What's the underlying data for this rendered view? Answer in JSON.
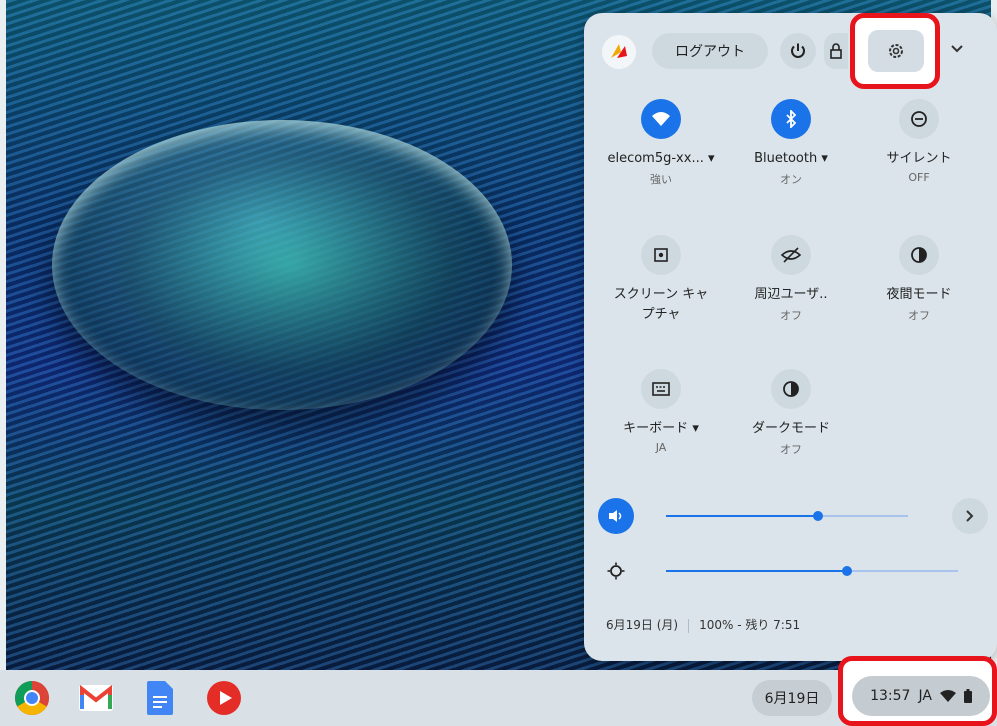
{
  "quick_settings": {
    "logout_label": "ログアウト",
    "tiles": [
      {
        "label": "elecom5g-xx...",
        "dropdown": "▾",
        "sub": "強い",
        "icon": "wifi-icon",
        "active": true
      },
      {
        "label": "Bluetooth",
        "dropdown": "▾",
        "sub": "オン",
        "icon": "bluetooth-icon",
        "active": true
      },
      {
        "label": "サイレント",
        "sub": "OFF",
        "icon": "do-not-disturb-icon",
        "active": false
      },
      {
        "label": "スクリーン キャプチャ",
        "sub": "",
        "icon": "screen-capture-icon",
        "active": false
      },
      {
        "label": "周辺ユーザ..",
        "sub": "オフ",
        "icon": "nearby-share-icon",
        "active": false
      },
      {
        "label": "夜間モード",
        "sub": "オフ",
        "icon": "night-light-icon",
        "active": false
      },
      {
        "label": "キーボード",
        "dropdown": "▾",
        "sub": "JA",
        "icon": "keyboard-icon",
        "active": false
      },
      {
        "label": "ダークモード",
        "sub": "オフ",
        "icon": "dark-mode-icon",
        "active": false
      }
    ],
    "volume_level": 0.63,
    "brightness_level": 0.62,
    "footer_date": "6月19日 (月)",
    "footer_battery": "100% - 残り 7:51"
  },
  "shelf": {
    "apps": [
      "chrome-icon",
      "gmail-icon",
      "docs-icon",
      "youtube-icon"
    ],
    "date": "6月19日",
    "time": "13:57",
    "ime": "JA"
  },
  "colors": {
    "accent": "#1a73e8",
    "highlight": "#e8141c"
  }
}
